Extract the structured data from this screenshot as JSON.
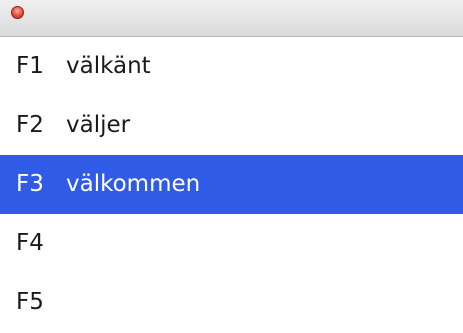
{
  "window": {
    "close_icon": "close-icon",
    "close_color": "#ec5a4a"
  },
  "candidates": [
    {
      "key": "F1",
      "word": "välkänt"
    },
    {
      "key": "F2",
      "word": "väljer"
    },
    {
      "key": "F3",
      "word": "välkommen"
    },
    {
      "key": "F4",
      "word": ""
    },
    {
      "key": "F5",
      "word": ""
    }
  ],
  "selected_index": 2,
  "colors": {
    "selection": "#2f5be6",
    "text": "#1a1a1a",
    "selected_text": "#ffffff"
  }
}
